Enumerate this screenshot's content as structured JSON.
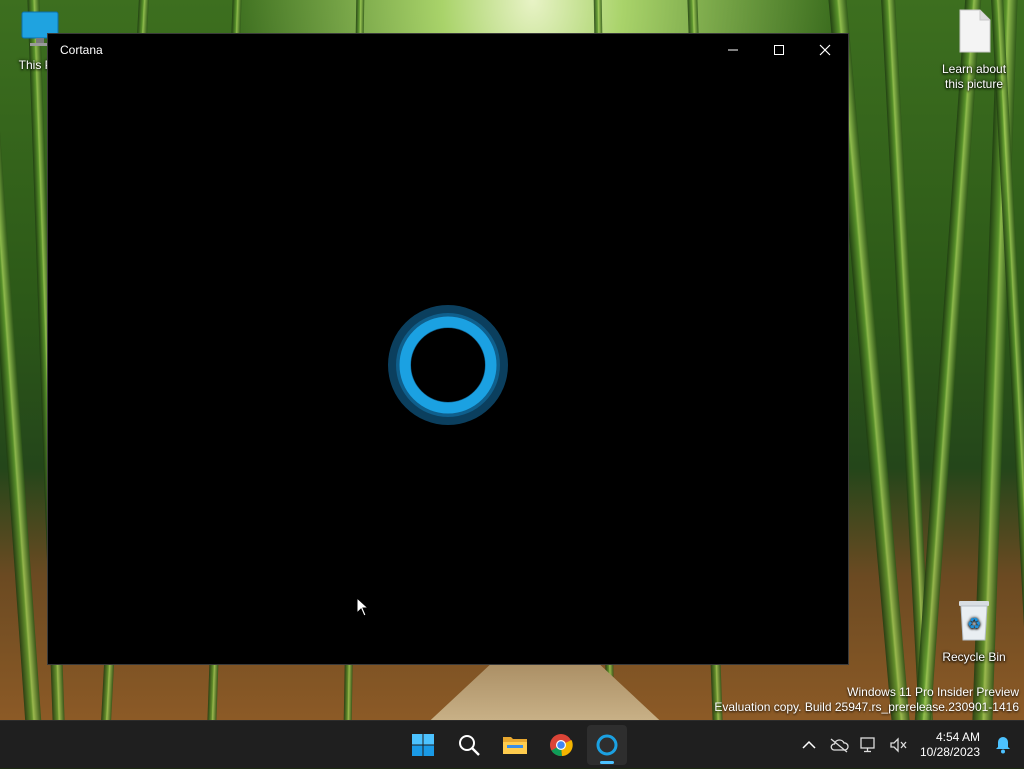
{
  "desktop": {
    "icons": {
      "this_pc": "This PC",
      "learn_picture": "Learn about this picture",
      "recycle_bin": "Recycle Bin"
    },
    "watermark": {
      "line1": "Windows 11 Pro Insider Preview",
      "line2": "Evaluation copy. Build 25947.rs_prerelease.230901-1416"
    }
  },
  "window": {
    "title": "Cortana",
    "controls": [
      "minimize",
      "maximize",
      "close"
    ],
    "accent_color": "#1ba1e2"
  },
  "taskbar": {
    "apps": [
      {
        "name": "Start",
        "icon": "windows-logo-icon"
      },
      {
        "name": "Search",
        "icon": "search-icon"
      },
      {
        "name": "File Explorer",
        "icon": "folder-icon"
      },
      {
        "name": "Google Chrome",
        "icon": "chrome-icon"
      },
      {
        "name": "Cortana",
        "icon": "cortana-icon",
        "active": true
      }
    ],
    "tray": {
      "time": "4:54 AM",
      "date": "10/28/2023"
    }
  }
}
